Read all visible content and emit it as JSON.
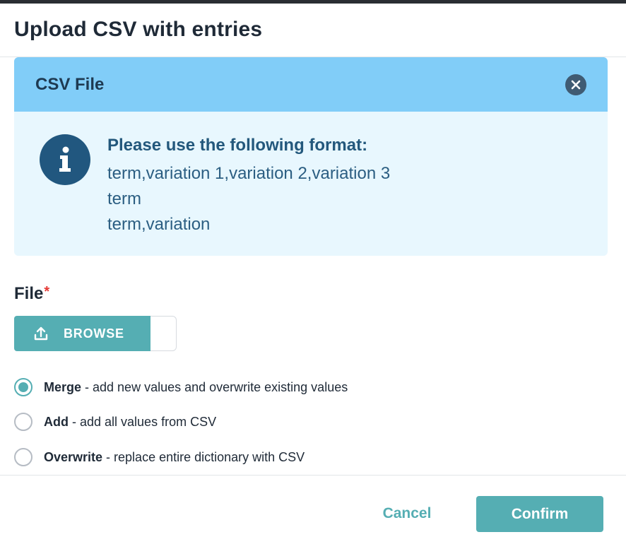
{
  "dialog": {
    "title": "Upload CSV with entries"
  },
  "csv_panel": {
    "title": "CSV File",
    "close_icon": "close-icon",
    "info_icon": "info-icon",
    "format_title": "Please use the following format:",
    "format_lines": [
      "term,variation 1,variation 2,variation 3",
      "term",
      "term,variation"
    ]
  },
  "file_field": {
    "label": "File",
    "required_marker": "*",
    "browse_label": "BROWSE",
    "browse_icon": "upload-icon",
    "value": ""
  },
  "import_mode": {
    "selected": "merge",
    "options": [
      {
        "id": "merge",
        "name": "Merge",
        "description": " - add new values and overwrite existing values"
      },
      {
        "id": "add",
        "name": "Add",
        "description": " - add all values from CSV"
      },
      {
        "id": "overwrite",
        "name": "Overwrite",
        "description": " - replace entire dictionary with CSV"
      }
    ]
  },
  "footer": {
    "cancel_label": "Cancel",
    "confirm_label": "Confirm"
  },
  "colors": {
    "accent": "#55aeb3",
    "panel_header": "#81cdf8",
    "panel_body": "#e8f7fe",
    "info_icon": "#21577f",
    "required": "#e53935"
  }
}
